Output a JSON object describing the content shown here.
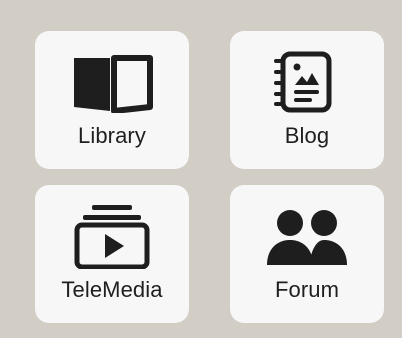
{
  "apps": [
    {
      "label": "Library",
      "icon": "book-open-icon"
    },
    {
      "label": "Blog",
      "icon": "notebook-icon"
    },
    {
      "label": "TeleMedia",
      "icon": "video-library-icon"
    },
    {
      "label": "Forum",
      "icon": "users-icon"
    }
  ],
  "colors": {
    "background": "#d3cec5",
    "tile": "#f7f7f7",
    "icon": "#1e1e1e",
    "text": "#1f1f1f"
  }
}
